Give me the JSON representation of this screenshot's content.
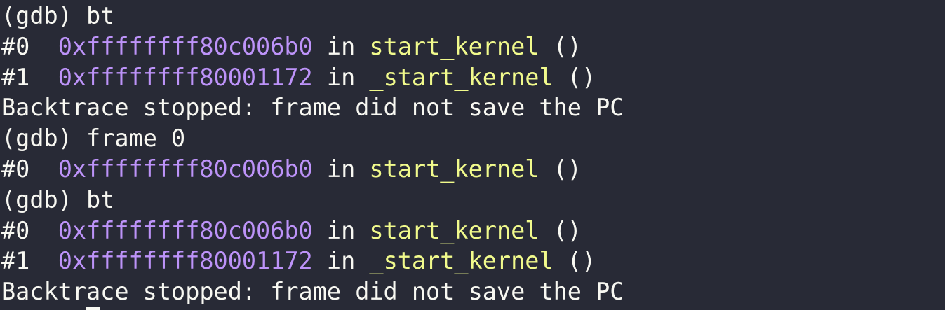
{
  "terminal": {
    "colors": {
      "background": "#282a36",
      "foreground": "#f8f8f2",
      "address": "#bd93f9",
      "function": "#f1fa8c"
    },
    "lines": [
      {
        "type": "prompt",
        "prompt": "(gdb) ",
        "command": "bt"
      },
      {
        "type": "frame",
        "index": "#0  ",
        "address": "0xffffffff80c006b0",
        "in": " in ",
        "function": "start_kernel",
        "args": " ()"
      },
      {
        "type": "frame",
        "index": "#1  ",
        "address": "0xffffffff80001172",
        "in": " in ",
        "function": "_start_kernel",
        "args": " ()"
      },
      {
        "type": "text",
        "text": "Backtrace stopped: frame did not save the PC"
      },
      {
        "type": "prompt",
        "prompt": "(gdb) ",
        "command": "frame 0"
      },
      {
        "type": "frame",
        "index": "#0  ",
        "address": "0xffffffff80c006b0",
        "in": " in ",
        "function": "start_kernel",
        "args": " ()"
      },
      {
        "type": "prompt",
        "prompt": "(gdb) ",
        "command": "bt"
      },
      {
        "type": "frame",
        "index": "#0  ",
        "address": "0xffffffff80c006b0",
        "in": " in ",
        "function": "start_kernel",
        "args": " ()"
      },
      {
        "type": "frame",
        "index": "#1  ",
        "address": "0xffffffff80001172",
        "in": " in ",
        "function": "_start_kernel",
        "args": " ()"
      },
      {
        "type": "text",
        "text": "Backtrace stopped: frame did not save the PC"
      }
    ]
  }
}
